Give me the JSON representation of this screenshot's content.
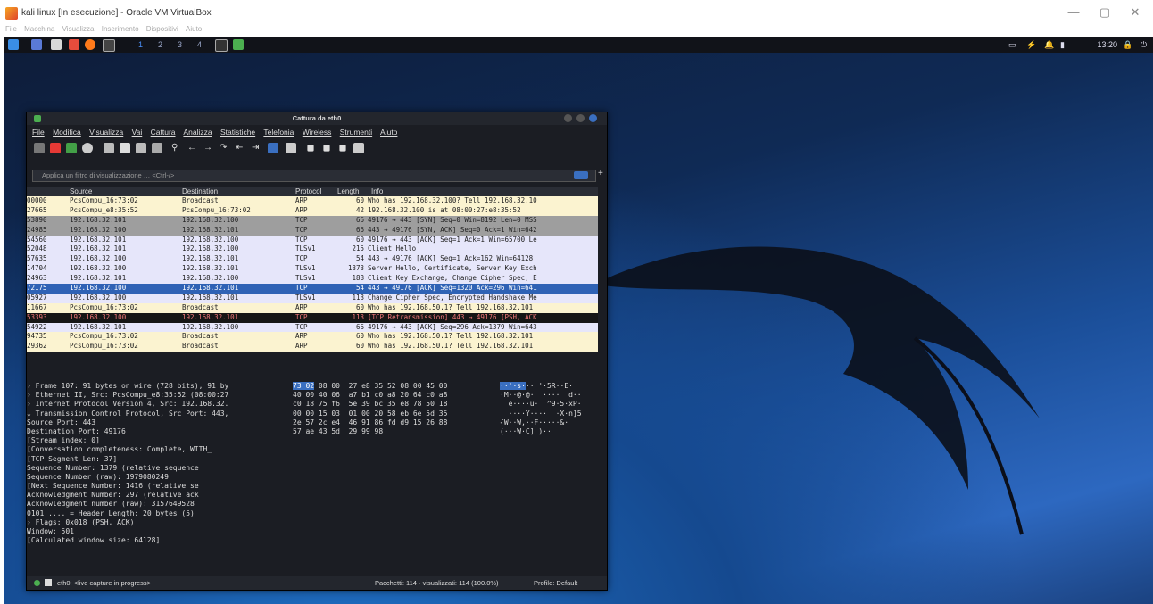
{
  "window": {
    "title": "kali linux [In esecuzione] - Oracle VM VirtualBox",
    "menu": [
      "File",
      "Macchina",
      "Visualizza",
      "Inserimento",
      "Dispositivi",
      "Aiuto"
    ],
    "controls": [
      "—",
      "▢",
      "✕"
    ]
  },
  "panel": {
    "workspaces": [
      "1",
      "2",
      "3",
      "4"
    ],
    "clock": "13:20"
  },
  "wireshark": {
    "title": "Cattura da eth0",
    "menu": [
      "File",
      "Modifica",
      "Visualizza",
      "Vai",
      "Cattura",
      "Analizza",
      "Statistiche",
      "Telefonia",
      "Wireless",
      "Strumenti",
      "Aiuto"
    ],
    "filter_placeholder": "Applica un filtro di visualizzazione … <Ctrl-/>",
    "columns": [
      "",
      "Source",
      "Destination",
      "Protocol",
      "Length",
      "Info"
    ],
    "packets": [
      {
        "t": "00000",
        "src": "PcsCompu_16:73:02",
        "dst": "Broadcast",
        "proto": "ARP",
        "len": "60",
        "info": "Who has 192.168.32.100? Tell 192.168.32.10",
        "bg": "#fbf3d0",
        "fg": "#222"
      },
      {
        "t": "27665",
        "src": "PcsCompu_e8:35:52",
        "dst": "PcsCompu_16:73:02",
        "proto": "ARP",
        "len": "42",
        "info": "192.168.32.100 is at 08:00:27:e8:35:52",
        "bg": "#fbf3d0",
        "fg": "#222"
      },
      {
        "t": "53890",
        "src": "192.168.32.101",
        "dst": "192.168.32.100",
        "proto": "TCP",
        "len": "66",
        "info": "49176 → 443 [SYN] Seq=0 Win=8192 Len=0 MSS",
        "bg": "#9e9e9e",
        "fg": "#222"
      },
      {
        "t": "24985",
        "src": "192.168.32.100",
        "dst": "192.168.32.101",
        "proto": "TCP",
        "len": "66",
        "info": "443 → 49176 [SYN, ACK] Seq=0 Ack=1 Win=642",
        "bg": "#9e9e9e",
        "fg": "#222"
      },
      {
        "t": "54560",
        "src": "192.168.32.101",
        "dst": "192.168.32.100",
        "proto": "TCP",
        "len": "60",
        "info": "49176 → 443 [ACK] Seq=1 Ack=1 Win=65700 Le",
        "bg": "#e6e6fa",
        "fg": "#222"
      },
      {
        "t": "52048",
        "src": "192.168.32.101",
        "dst": "192.168.32.100",
        "proto": "TLSv1",
        "len": "215",
        "info": "Client Hello",
        "bg": "#e6e6fa",
        "fg": "#222"
      },
      {
        "t": "57635",
        "src": "192.168.32.100",
        "dst": "192.168.32.101",
        "proto": "TCP",
        "len": "54",
        "info": "443 → 49176 [ACK] Seq=1 Ack=162 Win=64128",
        "bg": "#e6e6fa",
        "fg": "#222"
      },
      {
        "t": "14704",
        "src": "192.168.32.100",
        "dst": "192.168.32.101",
        "proto": "TLSv1",
        "len": "1373",
        "info": "Server Hello, Certificate, Server Key Exch",
        "bg": "#e6e6fa",
        "fg": "#222"
      },
      {
        "t": "24963",
        "src": "192.168.32.101",
        "dst": "192.168.32.100",
        "proto": "TLSv1",
        "len": "188",
        "info": "Client Key Exchange, Change Cipher Spec, E",
        "bg": "#e6e6fa",
        "fg": "#222"
      },
      {
        "t": "72175",
        "src": "192.168.32.100",
        "dst": "192.168.32.101",
        "proto": "TCP",
        "len": "54",
        "info": "443 → 49176 [ACK] Seq=1320 Ack=296 Win=641",
        "bg": "#2f62b5",
        "fg": "#fff"
      },
      {
        "t": "05927",
        "src": "192.168.32.100",
        "dst": "192.168.32.101",
        "proto": "TLSv1",
        "len": "113",
        "info": "Change Cipher Spec, Encrypted Handshake Me",
        "bg": "#e6e6fa",
        "fg": "#222"
      },
      {
        "t": "11667",
        "src": "PcsCompu_16:73:02",
        "dst": "Broadcast",
        "proto": "ARP",
        "len": "60",
        "info": "Who has 192.168.50.1? Tell 192.168.32.101",
        "bg": "#fbf3d0",
        "fg": "#222"
      },
      {
        "t": "53393",
        "src": "192.168.32.100",
        "dst": "192.168.32.101",
        "proto": "TCP",
        "len": "113",
        "info": "[TCP Retransmission] 443 → 49176 [PSH, ACK",
        "bg": "#161616",
        "fg": "#f07878"
      },
      {
        "t": "54922",
        "src": "192.168.32.101",
        "dst": "192.168.32.100",
        "proto": "TCP",
        "len": "66",
        "info": "49176 → 443 [ACK] Seq=296 Ack=1379 Win=643",
        "bg": "#e6e6fa",
        "fg": "#222"
      },
      {
        "t": "94735",
        "src": "PcsCompu_16:73:02",
        "dst": "Broadcast",
        "proto": "ARP",
        "len": "60",
        "info": "Who has 192.168.50.1? Tell 192.168.32.101",
        "bg": "#fbf3d0",
        "fg": "#222"
      },
      {
        "t": "29362",
        "src": "PcsCompu_16:73:02",
        "dst": "Broadcast",
        "proto": "ARP",
        "len": "60",
        "info": "Who has 192.168.50.1? Tell 192.168.32.101",
        "bg": "#fbf3d0",
        "fg": "#222"
      }
    ],
    "details": [
      "› Frame 107: 91 bytes on wire (728 bits), 91 by",
      "› Ethernet II, Src: PcsCompu_e8:35:52 (08:00:27",
      "› Internet Protocol Version 4, Src: 192.168.32.",
      "⌄ Transmission Control Protocol, Src Port: 443,",
      "    Source Port: 443",
      "    Destination Port: 49176",
      "    [Stream index: 0]",
      "    [Conversation completeness: Complete, WITH_",
      "    [TCP Segment Len: 37]",
      "    Sequence Number: 1379    (relative sequence",
      "    Sequence Number (raw): 1979080249",
      "    [Next Sequence Number: 1416    (relative se",
      "    Acknowledgment Number: 297    (relative ack",
      "    Acknowledgment number (raw): 3157649528",
      "    0101 .... = Header Length: 20 bytes (5)",
      "  › Flags: 0x018 (PSH, ACK)",
      "    Window: 501",
      "    [Calculated window size: 64128]"
    ],
    "hex": [
      {
        "hex_hl": "73 02",
        "hex": " 08 00  27 e8 35 52 08 00 45 00",
        "asc_hl": "··'·s·",
        "asc": "·· '·5R··E·"
      },
      {
        "hex_hl": "",
        "hex": "40 00 40 06  a7 b1 c0 a8 20 64 c0 a8",
        "asc_hl": "",
        "asc": "·M··@·@·  ····  d··"
      },
      {
        "hex_hl": "",
        "hex": "c0 18 75 f6  5e 39 bc 35 e8 78 50 18",
        "asc_hl": "",
        "asc": "  e····u·  ^9·5·xP·"
      },
      {
        "hex_hl": "",
        "hex": "00 00 15 03  01 00 20 58 eb 6e 5d 35",
        "asc_hl": "",
        "asc": "  ····Y····  ·X·n]5"
      },
      {
        "hex_hl": "",
        "hex": "2e 57 2c e4  46 91 86 fd d9 15 26 88",
        "asc_hl": "",
        "asc": "{W··W,··F·····&·"
      },
      {
        "hex_hl": "",
        "hex": "57 ae 43 5d  29 99 98",
        "asc_hl": "",
        "asc": "(···W·C] )··"
      }
    ],
    "status": {
      "capture": "eth0: <live capture in progress>",
      "packets": "Pacchetti: 114 · visualizzati: 114 (100.0%)",
      "profile": "Profilo: Default"
    }
  }
}
